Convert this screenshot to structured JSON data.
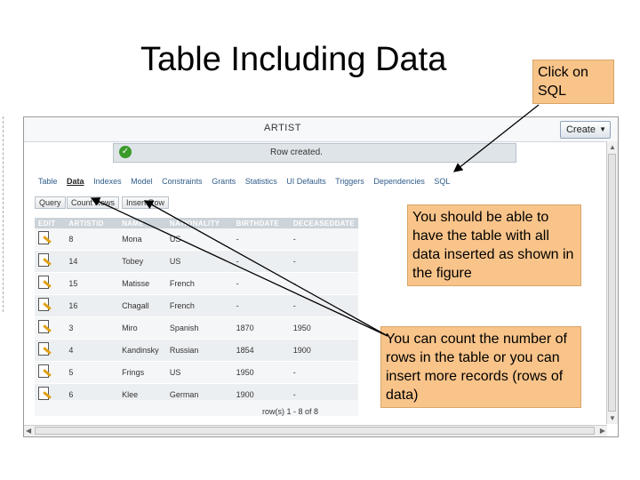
{
  "slide": {
    "title": "Table Including Data",
    "callout_sql": "Click on SQL",
    "callout_figure": "You should be able to have the table with all data inserted as shown in the figure",
    "callout_count": "You can count the number of rows in the table or you can insert more records (rows of data)"
  },
  "app": {
    "title": "ARTIST",
    "create_label": "Create",
    "message": "Row created.",
    "tabs": [
      "Table",
      "Data",
      "Indexes",
      "Model",
      "Constraints",
      "Grants",
      "Statistics",
      "UI Defaults",
      "Triggers",
      "Dependencies",
      "SQL"
    ],
    "active_tab": "Data",
    "buttons": {
      "query": "Query",
      "count_rows": "Count Rows",
      "insert_row": "Insert Row"
    },
    "columns": [
      "EDIT",
      "ARTISTID",
      "NAME",
      "NATIONALITY",
      "BIRTHDATE",
      "DECEASEDDATE"
    ],
    "rows": [
      {
        "id": "8",
        "name": "Mona",
        "nationality": "US",
        "birth": "-",
        "death": "-"
      },
      {
        "id": "14",
        "name": "Tobey",
        "nationality": "US",
        "birth": "-",
        "death": "-"
      },
      {
        "id": "15",
        "name": "Matisse",
        "nationality": "French",
        "birth": "-",
        "death": "-"
      },
      {
        "id": "16",
        "name": "Chagall",
        "nationality": "French",
        "birth": "-",
        "death": "-"
      },
      {
        "id": "3",
        "name": "Miro",
        "nationality": "Spanish",
        "birth": "1870",
        "death": "1950"
      },
      {
        "id": "4",
        "name": "Kandinsky",
        "nationality": "Russian",
        "birth": "1854",
        "death": "1900"
      },
      {
        "id": "5",
        "name": "Frings",
        "nationality": "US",
        "birth": "1950",
        "death": "-"
      },
      {
        "id": "6",
        "name": "Klee",
        "nationality": "German",
        "birth": "1900",
        "death": "-"
      }
    ],
    "row_count": "row(s) 1 - 8 of 8"
  },
  "icons": {
    "edit": "edit-icon",
    "success": "check-icon",
    "caret": "chevron-down-icon"
  }
}
